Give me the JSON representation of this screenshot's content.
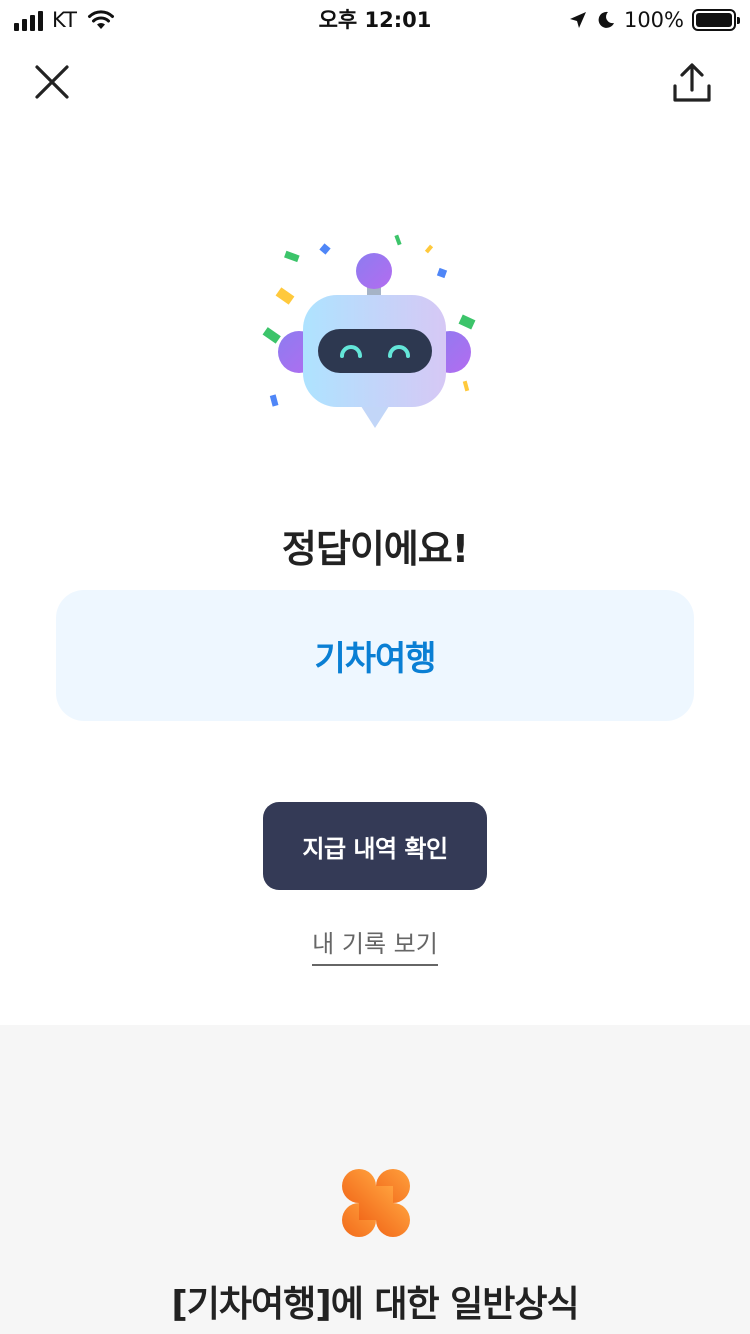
{
  "status_bar": {
    "carrier": "KT",
    "time": "오후 12:01",
    "battery_percent": "100%",
    "battery_level": 1.0
  },
  "toolbar": {
    "close_icon": "close-icon",
    "share_icon": "share-icon"
  },
  "result": {
    "title": "정답이에요!",
    "answer": "기차여행"
  },
  "actions": {
    "primary_label": "지급 내역 확인",
    "history_label": "내 기록 보기"
  },
  "knowledge": {
    "icon": "clover-icon",
    "title": "[기차여행]에 대한 일반상식"
  },
  "colors": {
    "accent_blue": "#0a7fd4",
    "answer_bg": "#eef7ff",
    "primary_btn": "#343a56",
    "clover_orange": "#f7882e",
    "section_bg": "#f6f6f6"
  }
}
